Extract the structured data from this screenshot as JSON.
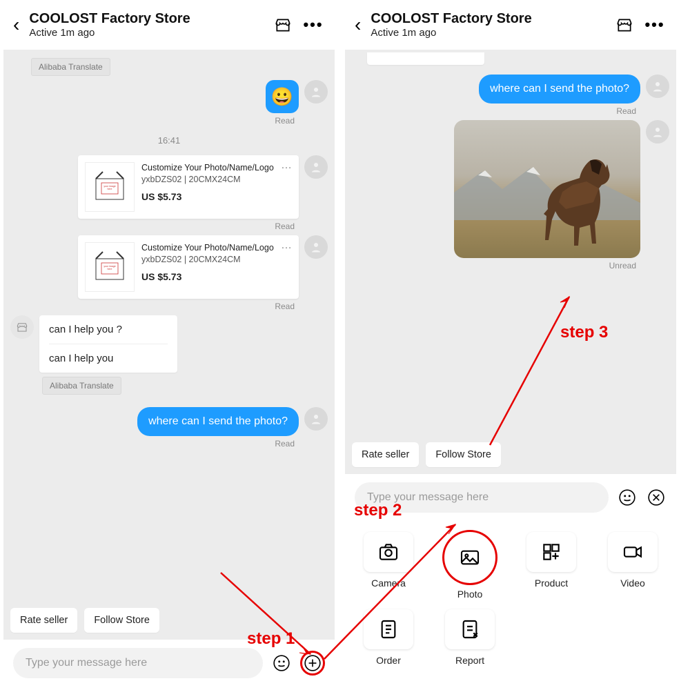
{
  "header": {
    "store_name": "COOLOST Factory Store",
    "status": "Active 1m ago"
  },
  "left": {
    "translate": "Alibaba Translate",
    "timestamp": "16:41",
    "emoji": "😀",
    "emoji_status": "Read",
    "product": {
      "title": "Customize Your Photo/Name/Logo",
      "sku": "yxbDZS02 | 20CMX24CM",
      "price": "US $5.73",
      "status": "Read"
    },
    "seller_msgs": {
      "m1": "can I help you ?",
      "m2": "can I help you",
      "translate": "Alibaba Translate"
    },
    "user_msg": {
      "text": "where can I send the photo?",
      "status": "Read"
    }
  },
  "right": {
    "user_msg": {
      "text": "where can I send the photo?",
      "status": "Read"
    },
    "photo_status": "Unread"
  },
  "chips": {
    "rate": "Rate seller",
    "follow": "Follow Store"
  },
  "input": {
    "placeholder": "Type your message here"
  },
  "attach": {
    "camera": "Camera",
    "photo": "Photo",
    "product": "Product",
    "video": "Video",
    "order": "Order",
    "report": "Report"
  },
  "annotations": {
    "s1": "step 1",
    "s2": "step 2",
    "s3": "step 3"
  }
}
